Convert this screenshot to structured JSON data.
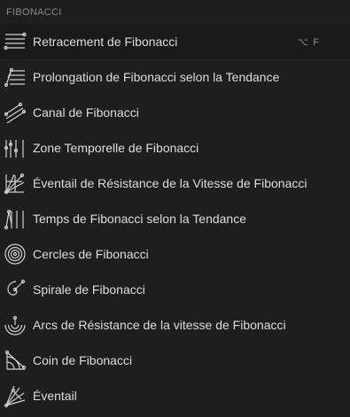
{
  "section": {
    "title": "FIBONACCI"
  },
  "items": [
    {
      "label": "Retracement de Fibonacci",
      "shortcut": "⌥ F",
      "icon": "fib-retracement-icon"
    },
    {
      "label": "Prolongation de Fibonacci selon la Tendance",
      "icon": "fib-trend-extension-icon"
    },
    {
      "label": "Canal de Fibonacci",
      "icon": "fib-channel-icon"
    },
    {
      "label": "Zone Temporelle de Fibonacci",
      "icon": "fib-time-zone-icon"
    },
    {
      "label": "Éventail de Résistance de la Vitesse de Fibonacci",
      "icon": "fib-speed-fan-icon"
    },
    {
      "label": "Temps de Fibonacci selon la Tendance",
      "icon": "fib-trend-time-icon"
    },
    {
      "label": "Cercles de Fibonacci",
      "icon": "fib-circles-icon"
    },
    {
      "label": "Spirale de Fibonacci",
      "icon": "fib-spiral-icon"
    },
    {
      "label": "Arcs de Résistance de la vitesse de Fibonacci",
      "icon": "fib-speed-arcs-icon"
    },
    {
      "label": "Coin de Fibonacci",
      "icon": "fib-wedge-icon"
    },
    {
      "label": "Éventail",
      "icon": "pitchfan-icon"
    }
  ]
}
